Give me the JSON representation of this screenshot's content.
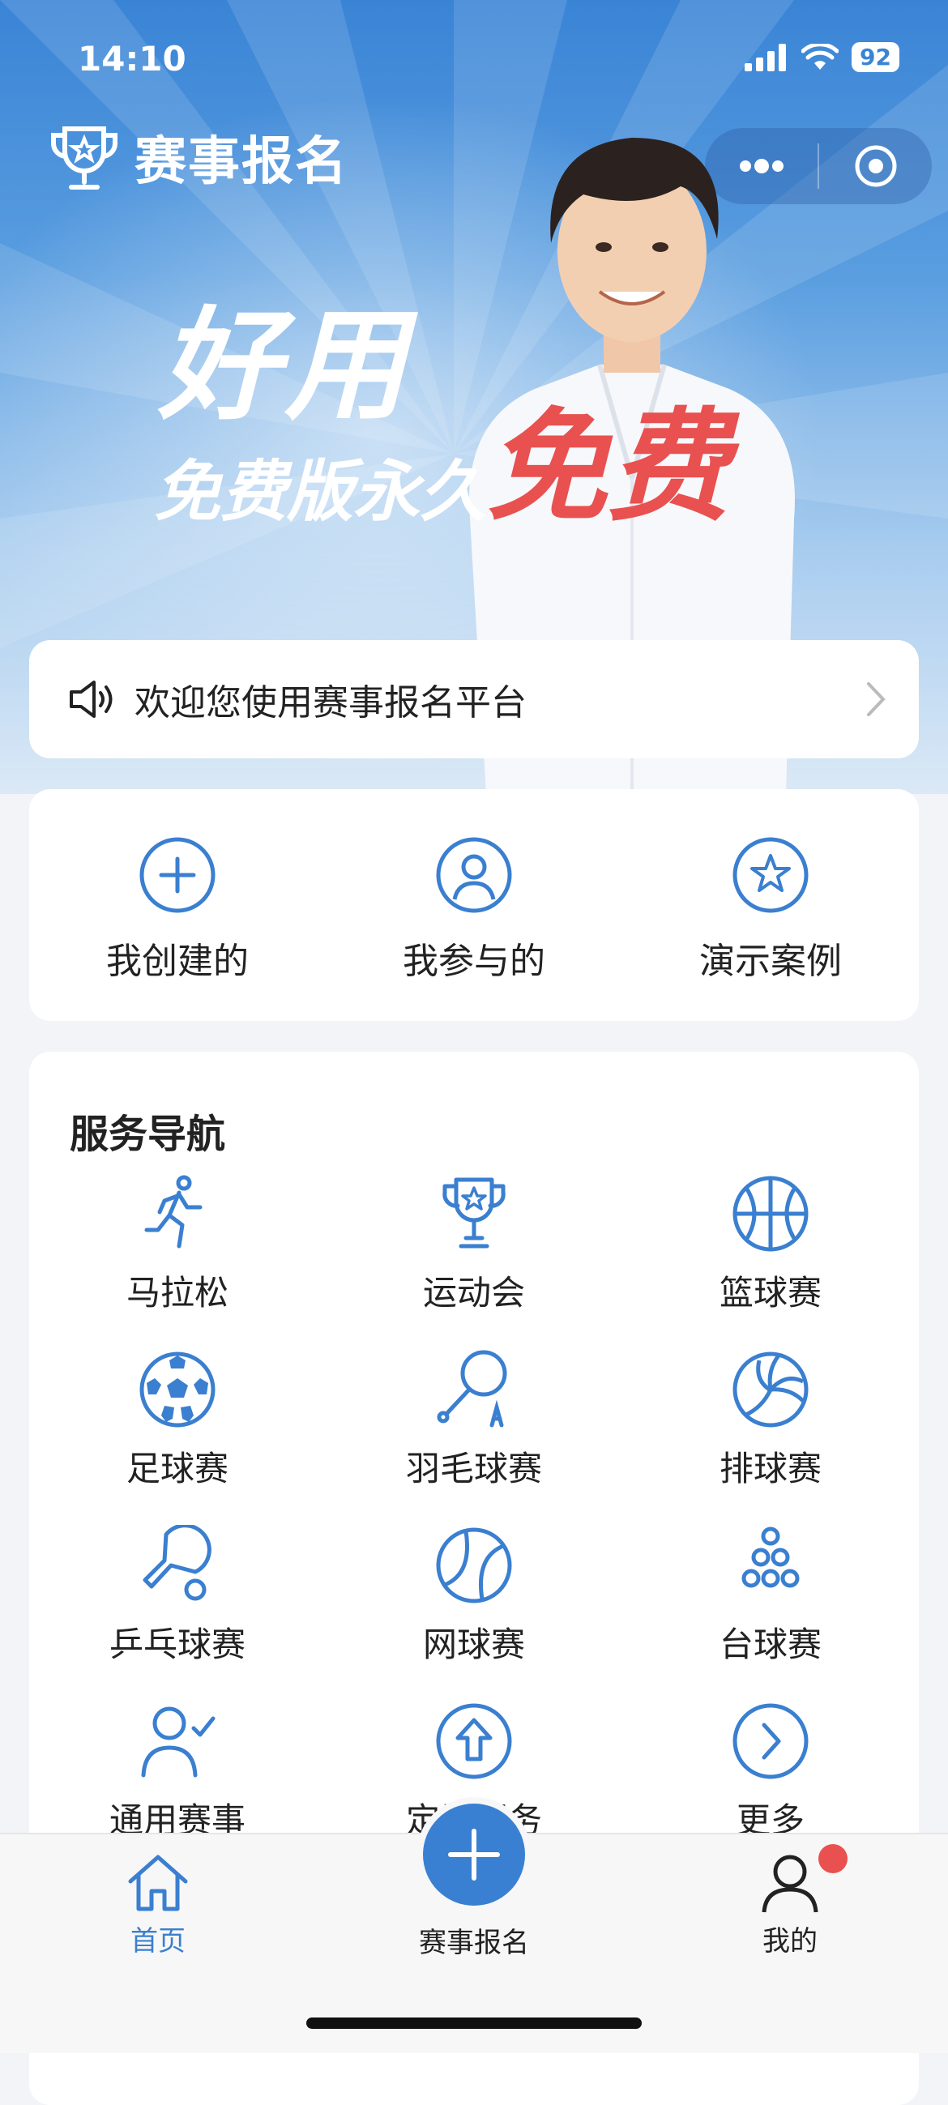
{
  "status_bar": {
    "time": "14:10",
    "battery": "92"
  },
  "header": {
    "title": "赛事报名"
  },
  "banner": {
    "slogan_main": "好用",
    "slogan_sub": "免费版永久",
    "slogan_highlight": "免费"
  },
  "notice": {
    "text": "欢迎您使用赛事报名平台"
  },
  "quick_links": [
    {
      "label": "我创建的",
      "icon": "plus-circle-icon"
    },
    {
      "label": "我参与的",
      "icon": "user-circle-icon"
    },
    {
      "label": "演示案例",
      "icon": "star-circle-icon"
    }
  ],
  "services": {
    "title": "服务导航",
    "items": [
      {
        "label": "马拉松",
        "icon": "runner-icon"
      },
      {
        "label": "运动会",
        "icon": "trophy-icon"
      },
      {
        "label": "篮球赛",
        "icon": "basketball-icon"
      },
      {
        "label": "足球赛",
        "icon": "football-icon"
      },
      {
        "label": "羽毛球赛",
        "icon": "badminton-icon"
      },
      {
        "label": "排球赛",
        "icon": "volleyball-icon"
      },
      {
        "label": "乒乓球赛",
        "icon": "pingpong-icon"
      },
      {
        "label": "网球赛",
        "icon": "tennis-icon"
      },
      {
        "label": "台球赛",
        "icon": "billiards-icon"
      },
      {
        "label": "通用赛事",
        "icon": "user-check-icon"
      },
      {
        "label": "定制服务",
        "icon": "upload-circle-icon"
      },
      {
        "label": "更多",
        "icon": "chevron-circle-icon"
      }
    ]
  },
  "tabbar": {
    "home": "首页",
    "register": "赛事报名",
    "me": "我的"
  },
  "colors": {
    "accent": "#3a7fd0",
    "highlight": "#e8514f"
  }
}
